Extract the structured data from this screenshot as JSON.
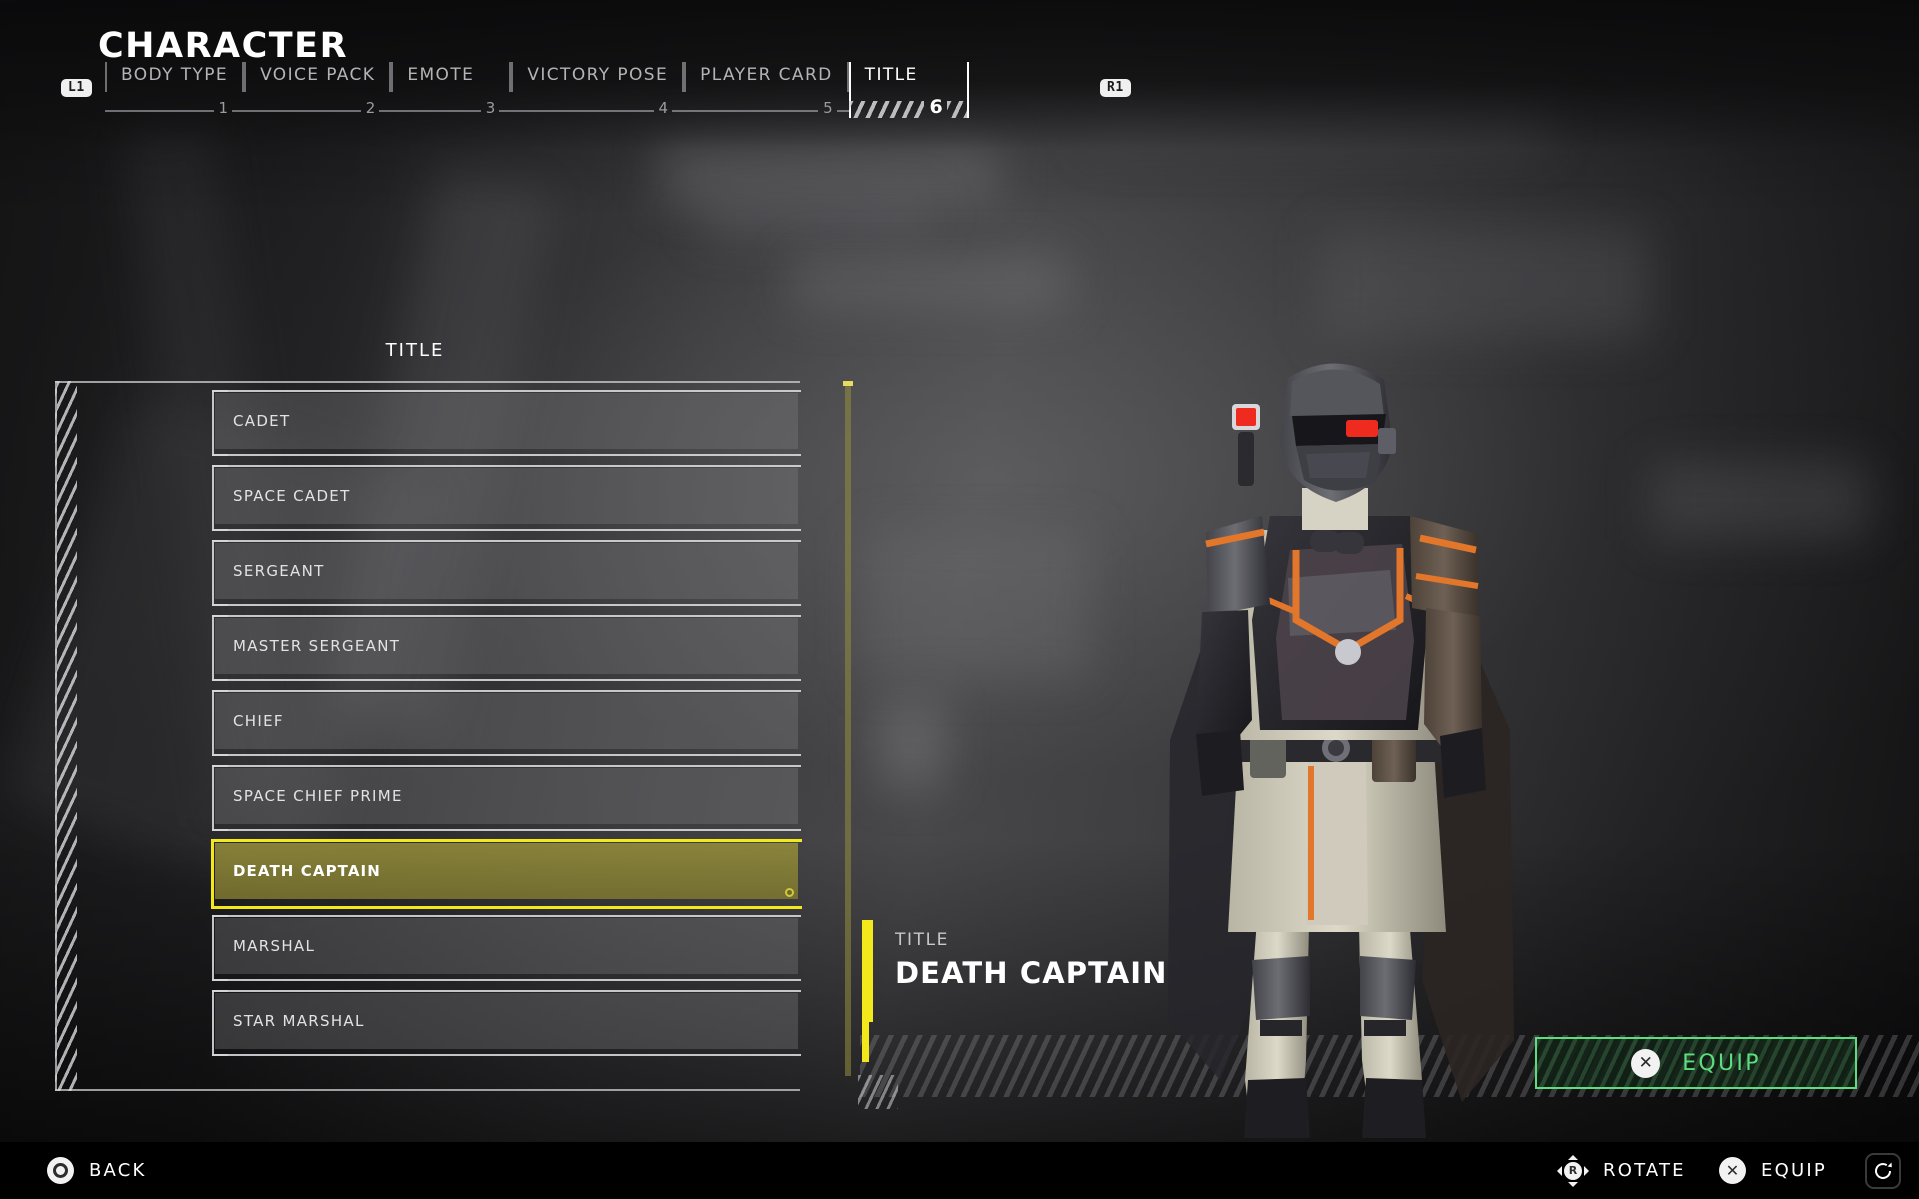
{
  "header": {
    "title": "CHARACTER",
    "left_bumper": "L1",
    "right_bumper": "R1",
    "tabs": [
      {
        "label": "BODY TYPE",
        "number": "1",
        "active": false
      },
      {
        "label": "VOICE PACK",
        "number": "2",
        "active": false
      },
      {
        "label": "EMOTE",
        "number": "3",
        "active": false
      },
      {
        "label": "VICTORY POSE",
        "number": "4",
        "active": false
      },
      {
        "label": "PLAYER CARD",
        "number": "5",
        "active": false
      },
      {
        "label": "TITLE",
        "number": "6",
        "active": true
      }
    ]
  },
  "list": {
    "heading": "TITLE",
    "items": [
      {
        "label": "CADET",
        "selected": false
      },
      {
        "label": "SPACE CADET",
        "selected": false
      },
      {
        "label": "SERGEANT",
        "selected": false
      },
      {
        "label": "MASTER SERGEANT",
        "selected": false
      },
      {
        "label": "CHIEF",
        "selected": false
      },
      {
        "label": "SPACE CHIEF PRIME",
        "selected": false
      },
      {
        "label": "DEATH CAPTAIN",
        "selected": true
      },
      {
        "label": "MARSHAL",
        "selected": false
      },
      {
        "label": "STAR MARSHAL",
        "selected": false
      }
    ]
  },
  "info": {
    "label": "TITLE",
    "value": "DEATH CAPTAIN"
  },
  "equip_button": {
    "label": "EQUIP",
    "glyph": "cross-button-icon",
    "glyph_text": "✕",
    "accent_color": "#5ddd7e"
  },
  "footer": {
    "back": {
      "label": "BACK",
      "glyph": "circle-button-icon"
    },
    "rotate": {
      "label": "ROTATE",
      "glyph": "right-stick-icon",
      "stick_letter": "R"
    },
    "equip": {
      "label": "EQUIP",
      "glyph": "cross-button-icon",
      "glyph_text": "✕"
    },
    "refresh": {
      "glyph": "refresh-icon"
    }
  },
  "colors": {
    "selection_yellow": "#f2e81c",
    "equip_green": "#5ddd7e",
    "panel_line": "#cdcdd0",
    "armor_orange": "#e2762a"
  }
}
